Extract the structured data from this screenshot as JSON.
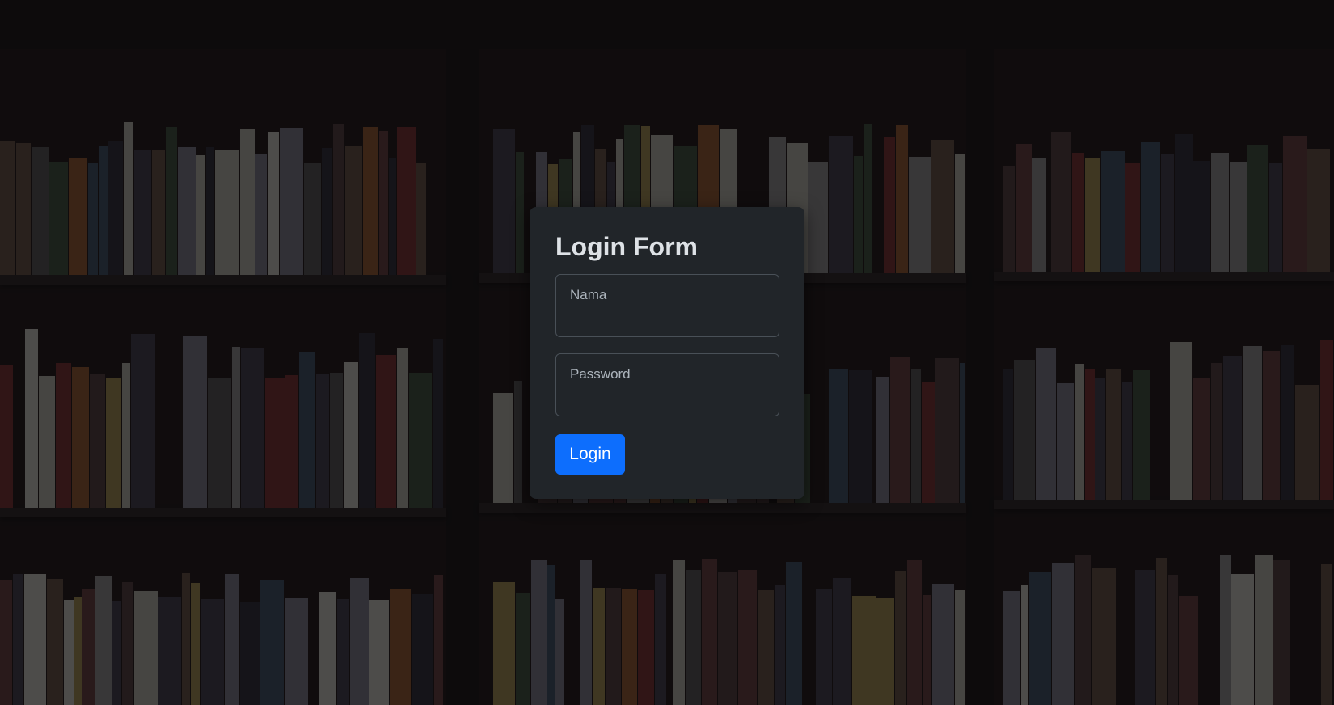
{
  "colors": {
    "card_background": "#212529",
    "button_primary": "#0d6efd",
    "text_light": "#dee2e6",
    "label_muted": "#adb5bd"
  },
  "login_form": {
    "title": "Login Form",
    "name_field": {
      "label": "Nama",
      "value": ""
    },
    "password_field": {
      "label": "Password",
      "value": ""
    },
    "submit_label": "Login"
  }
}
